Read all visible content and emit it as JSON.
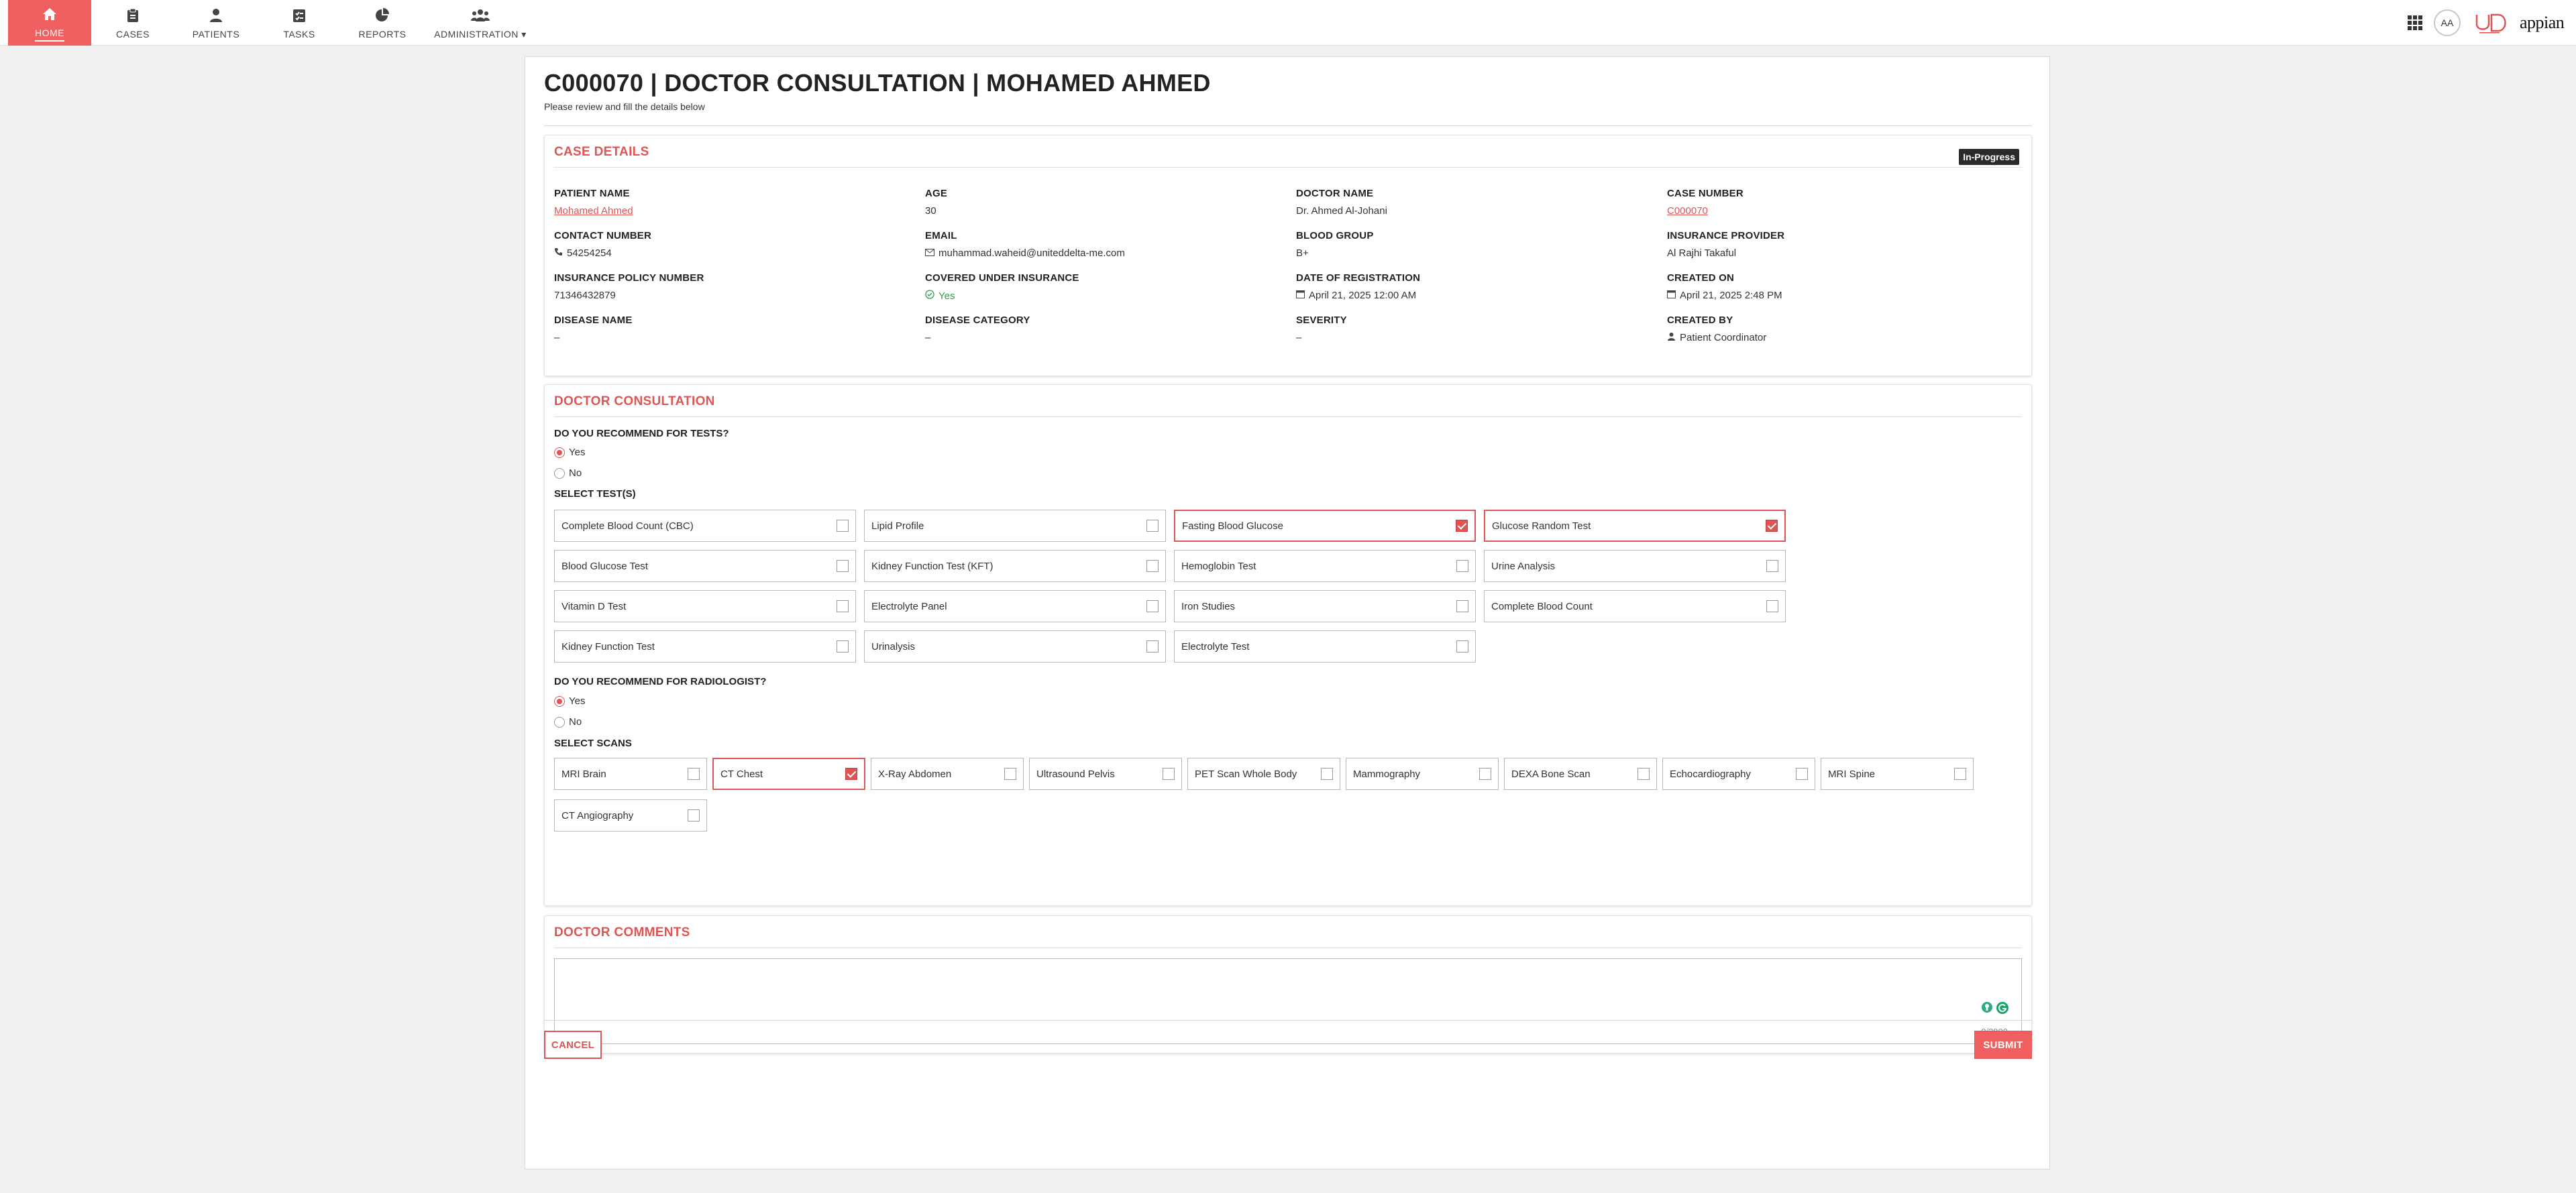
{
  "nav": {
    "items": [
      {
        "label": "HOME",
        "icon": "home-icon",
        "active": true
      },
      {
        "label": "CASES",
        "icon": "clipboard-icon"
      },
      {
        "label": "PATIENTS",
        "icon": "person-icon"
      },
      {
        "label": "TASKS",
        "icon": "tasks-icon"
      },
      {
        "label": "REPORTS",
        "icon": "pie-chart-icon"
      },
      {
        "label": "ADMINISTRATION",
        "icon": "users-group-icon"
      }
    ],
    "avatar_initials": "AA",
    "brand_logo": "appian"
  },
  "page": {
    "title": "C000070 | DOCTOR CONSULTATION | MOHAMED AHMED",
    "subtitle": "Please review and fill the details below"
  },
  "case_details": {
    "title": "CASE DETAILS",
    "status": "In-Progress",
    "patient_name_label": "PATIENT NAME",
    "patient_name": "Mohamed Ahmed",
    "age_label": "AGE",
    "age": "30",
    "doctor_name_label": "DOCTOR NAME",
    "doctor_name": "Dr. Ahmed Al-Johani",
    "case_number_label": "CASE NUMBER",
    "case_number": "C000070",
    "contact_label": "CONTACT NUMBER",
    "contact": "54254254",
    "email_label": "EMAIL",
    "email": "muhammad.waheid@uniteddelta-me.com",
    "blood_group_label": "BLOOD GROUP",
    "blood_group": "B+",
    "insurance_provider_label": "INSURANCE PROVIDER",
    "insurance_provider": "Al Rajhi Takaful",
    "policy_label": "INSURANCE POLICY NUMBER",
    "policy": "71346432879",
    "covered_label": "COVERED UNDER INSURANCE",
    "covered": "Yes",
    "registration_label": "DATE OF REGISTRATION",
    "registration": "April 21, 2025 12:00 AM",
    "created_on_label": "CREATED ON",
    "created_on": "April 21, 2025 2:48 PM",
    "disease_name_label": "DISEASE NAME",
    "disease_name": "–",
    "disease_category_label": "DISEASE CATEGORY",
    "disease_category": "–",
    "severity_label": "SEVERITY",
    "severity": "–",
    "created_by_label": "CREATED BY",
    "created_by": "Patient Coordinator"
  },
  "consultation": {
    "title": "DOCTOR CONSULTATION",
    "tests_question": "DO YOU RECOMMEND FOR TESTS?",
    "tests_yes": "Yes",
    "tests_no": "No",
    "tests_selected": "Yes",
    "select_tests_label": "SELECT TEST(S)",
    "tests": [
      {
        "label": "Complete Blood Count (CBC)",
        "checked": false
      },
      {
        "label": "Lipid Profile",
        "checked": false
      },
      {
        "label": "Fasting Blood Glucose",
        "checked": true
      },
      {
        "label": "Glucose Random Test",
        "checked": true
      },
      {
        "label": "Blood Glucose Test",
        "checked": false
      },
      {
        "label": "Kidney Function Test (KFT)",
        "checked": false
      },
      {
        "label": "Hemoglobin Test",
        "checked": false
      },
      {
        "label": "Urine Analysis",
        "checked": false
      },
      {
        "label": "Vitamin D Test",
        "checked": false
      },
      {
        "label": "Electrolyte Panel",
        "checked": false
      },
      {
        "label": "Iron Studies",
        "checked": false
      },
      {
        "label": "Complete Blood Count",
        "checked": false
      },
      {
        "label": "Kidney Function Test",
        "checked": false
      },
      {
        "label": "Urinalysis",
        "checked": false
      },
      {
        "label": "Electrolyte Test",
        "checked": false
      }
    ],
    "radiologist_question": "DO YOU RECOMMEND FOR RADIOLOGIST?",
    "radiologist_yes": "Yes",
    "radiologist_no": "No",
    "radiologist_selected": "Yes",
    "select_scans_label": "SELECT SCANS",
    "scans": [
      {
        "label": "MRI Brain",
        "checked": false
      },
      {
        "label": "CT Chest",
        "checked": true
      },
      {
        "label": "X-Ray Abdomen",
        "checked": false
      },
      {
        "label": "Ultrasound Pelvis",
        "checked": false
      },
      {
        "label": "PET Scan Whole Body",
        "checked": false
      },
      {
        "label": "Mammography",
        "checked": false
      },
      {
        "label": "DEXA Bone Scan",
        "checked": false
      },
      {
        "label": "Echocardiography",
        "checked": false
      },
      {
        "label": "MRI Spine",
        "checked": false
      },
      {
        "label": "CT Angiography",
        "checked": false
      }
    ]
  },
  "comments": {
    "title": "DOCTOR COMMENTS",
    "value": "",
    "char_count": "0/2000"
  },
  "actions": {
    "cancel": "CANCEL",
    "submit": "SUBMIT"
  },
  "colors": {
    "accent": "#e05454",
    "nav_active": "#f06060",
    "success": "#2e9e4a",
    "badge": "#2a2a2a"
  }
}
